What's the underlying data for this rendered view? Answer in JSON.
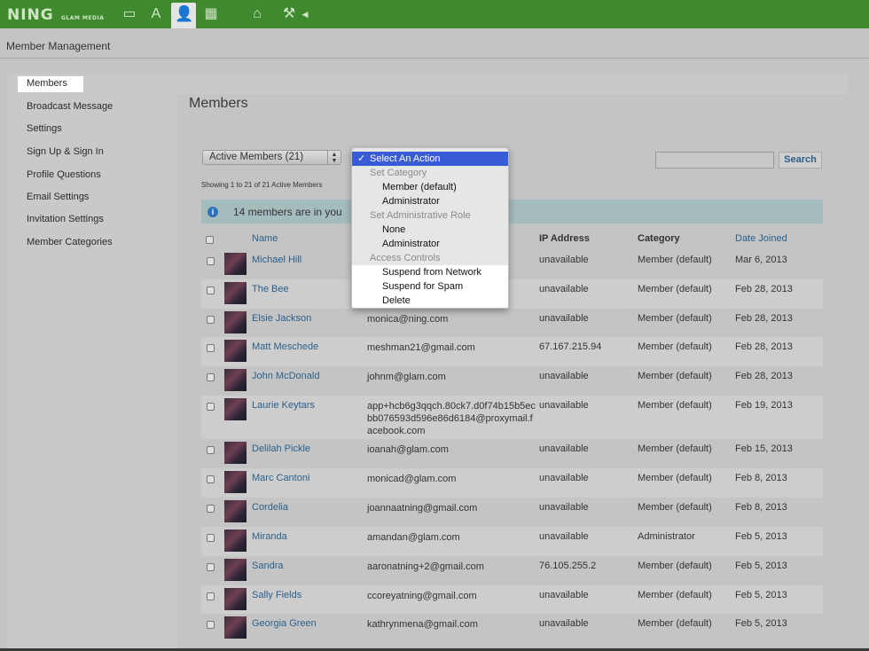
{
  "topbar": {
    "logo": "NING",
    "logo_sub": "GLAM MEDIA",
    "icons": [
      "monitor-icon",
      "appearance-icon",
      "members-icon",
      "apps-icon",
      "home-icon",
      "tools-icon",
      "collapse-arrow-icon"
    ],
    "active_icon": "members-icon",
    "color": "#3f8a2e"
  },
  "subheader": {
    "title": "Member Management"
  },
  "sidebar": {
    "items": [
      {
        "label": "Members",
        "active": true
      },
      {
        "label": "Broadcast Message"
      },
      {
        "label": "Settings"
      },
      {
        "label": "Sign Up & Sign In"
      },
      {
        "label": "Profile Questions"
      },
      {
        "label": "Email Settings"
      },
      {
        "label": "Invitation Settings"
      },
      {
        "label": "Member Categories"
      }
    ]
  },
  "main": {
    "heading": "Members",
    "filter_select": {
      "value": "Active Members (21)"
    },
    "showing": "Showing 1 to 21 of 21 Active Members",
    "search": {
      "value": "",
      "button": "Search"
    },
    "info": {
      "text": "14 members are in you"
    },
    "columns": {
      "name": "Name",
      "ip": "IP Address",
      "category": "Category",
      "date": "Date Joined"
    },
    "members": [
      {
        "name": "Michael Hill",
        "email": "",
        "ip": "unavailable",
        "category": "Member (default)",
        "date": "Mar 6, 2013"
      },
      {
        "name": "The Bee",
        "email": "",
        "ip": "unavailable",
        "category": "Member (default)",
        "date": "Feb 28, 2013"
      },
      {
        "name": "Elsie Jackson",
        "email": "monica@ning.com",
        "ip": "unavailable",
        "category": "Member (default)",
        "date": "Feb 28, 2013"
      },
      {
        "name": "Matt Meschede",
        "email": "meshman21@gmail.com",
        "ip": "67.167.215.94",
        "category": "Member (default)",
        "date": "Feb 28, 2013"
      },
      {
        "name": "John McDonald",
        "email": "johnm@glam.com",
        "ip": "unavailable",
        "category": "Member (default)",
        "date": "Feb 28, 2013"
      },
      {
        "name": "Laurie Keytars",
        "email": "app+hcb6g3qqch.80ck7.d0f74b15b5ecbb076593d596e86d6184@proxymail.facebook.com",
        "ip": "unavailable",
        "category": "Member (default)",
        "date": "Feb 19, 2013"
      },
      {
        "name": "Delilah Pickle",
        "email": "ioanah@glam.com",
        "ip": "unavailable",
        "category": "Member (default)",
        "date": "Feb 15, 2013"
      },
      {
        "name": "Marc Cantoni",
        "email": "monicad@glam.com",
        "ip": "unavailable",
        "category": "Member (default)",
        "date": "Feb 8, 2013"
      },
      {
        "name": "Cordelia",
        "email": "joannaatning@gmail.com",
        "ip": "unavailable",
        "category": "Member (default)",
        "date": "Feb 8, 2013"
      },
      {
        "name": "Miranda",
        "email": "amandan@glam.com",
        "ip": "unavailable",
        "category": "Administrator",
        "date": "Feb 5, 2013"
      },
      {
        "name": "Sandra",
        "email": "aaronatning+2@gmail.com",
        "ip": "76.105.255.2",
        "category": "Member (default)",
        "date": "Feb 5, 2013"
      },
      {
        "name": "Sally Fields",
        "email": "ccoreyatning@gmail.com",
        "ip": "unavailable",
        "category": "Member (default)",
        "date": "Feb 5, 2013"
      },
      {
        "name": "Georgia Green",
        "email": "kathrynmena@gmail.com",
        "ip": "unavailable",
        "category": "Member (default)",
        "date": "Feb 5, 2013"
      }
    ]
  },
  "action_menu": {
    "selected": "Select An Action",
    "check": "✓",
    "items": [
      {
        "type": "header",
        "label": "Set Category"
      },
      {
        "type": "option",
        "label": "Member (default)"
      },
      {
        "type": "option",
        "label": "Administrator"
      },
      {
        "type": "header",
        "label": "Set Administrative Role"
      },
      {
        "type": "option",
        "label": "None"
      },
      {
        "type": "option",
        "label": "Administrator"
      },
      {
        "type": "header",
        "label": "Access Controls"
      },
      {
        "type": "option",
        "label": "Suspend from Network"
      },
      {
        "type": "option",
        "label": "Suspend for Spam"
      },
      {
        "type": "option",
        "label": "Delete"
      }
    ],
    "highlight_color": "#3a5bd6"
  }
}
